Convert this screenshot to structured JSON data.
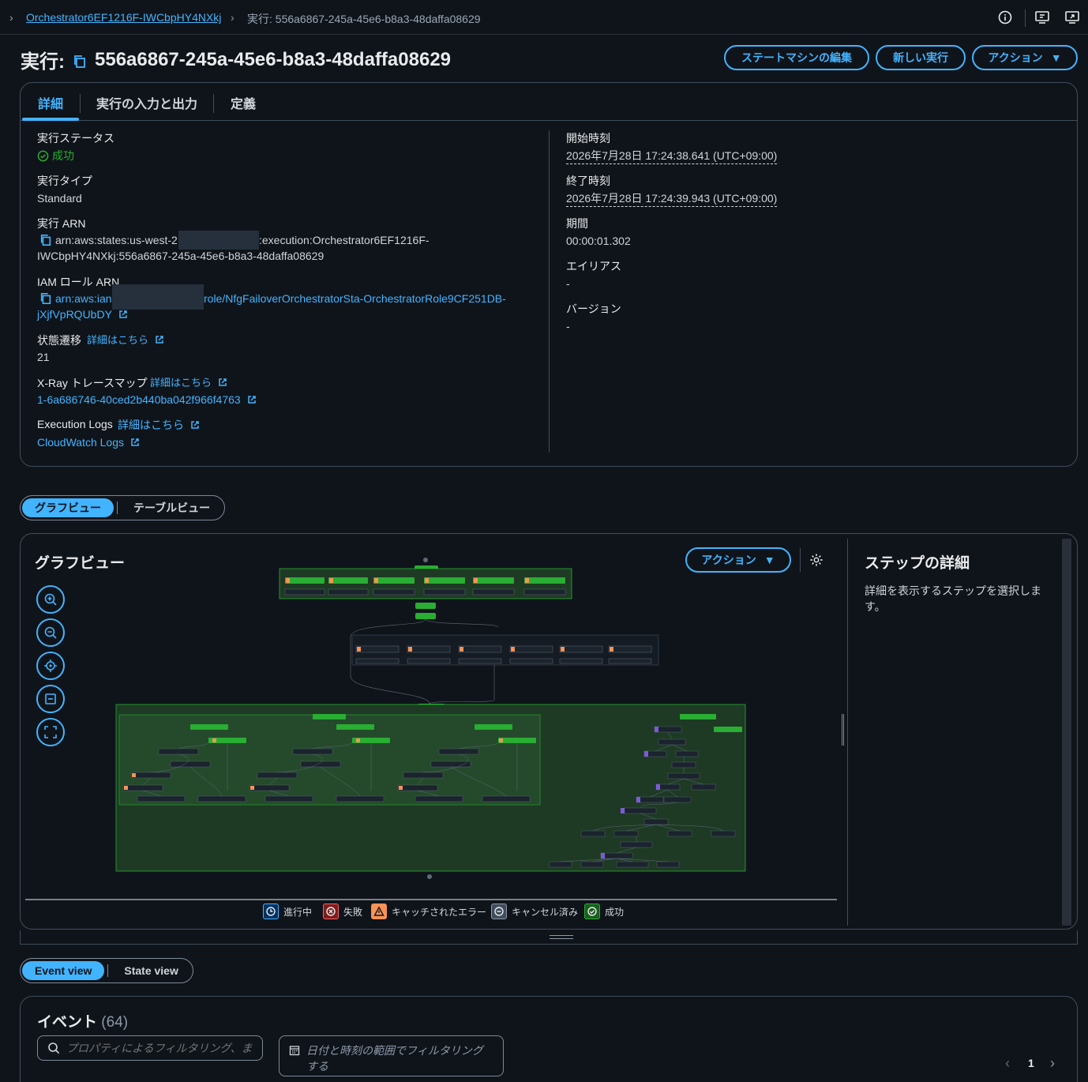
{
  "breadcrumb": {
    "parent": "Orchestrator6EF1216F-IWCbpHY4NXkj",
    "current": "実行: 556a6867-245a-45e6-b8a3-48daffa08629"
  },
  "header": {
    "title_prefix": "実行:",
    "execution_id": "556a6867-245a-45e6-b8a3-48daffa08629",
    "buttons": {
      "edit_state_machine": "ステートマシンの編集",
      "new_execution": "新しい実行",
      "actions": "アクション"
    }
  },
  "tabs": [
    "詳細",
    "実行の入力と出力",
    "定義"
  ],
  "details": {
    "status_label": "実行ステータス",
    "status_value": "成功",
    "type_label": "実行タイプ",
    "type_value": "Standard",
    "arn_label": "実行 ARN",
    "arn_line1_a": "arn:aws:states:us-west-2",
    "arn_line1_b": ":execution:Orchestrator6EF1216F-",
    "arn_line2": "IWCbpHY4NXkj:556a6867-245a-45e6-b8a3-48daffa08629",
    "iam_label": "IAM ロール ARN",
    "iam_line1_a": "arn:aws:ian",
    "iam_line1_b": "role/NfgFailoverOrchestratorSta-OrchestratorRole9CF251DB-",
    "iam_line2": "jXjfVpRQUbDY",
    "transitions_label": "状態遷移",
    "learn_more": "詳細はこちら",
    "transitions_value": "21",
    "xray_label": "X-Ray トレースマップ",
    "xray_value": "1-6a686746-40ced2b440ba042f966f4763",
    "logs_label": "Execution Logs",
    "logs_value": "CloudWatch Logs",
    "start_label": "開始時刻",
    "start_value": "2026年7月28日 17:24:38.641 (UTC+09:00)",
    "end_label": "終了時刻",
    "end_value": "2026年7月28日 17:24:39.943 (UTC+09:00)",
    "duration_label": "期間",
    "duration_value": "00:00:01.302",
    "alias_label": "エイリアス",
    "alias_value": "-",
    "version_label": "バージョン",
    "version_value": "-"
  },
  "view_toggle": {
    "graph": "グラフビュー",
    "table": "テーブルビュー"
  },
  "graph": {
    "title": "グラフビュー",
    "actions": "アクション",
    "legend": [
      "進行中",
      "失敗",
      "キャッチされたエラー",
      "キャンセル済み",
      "成功"
    ],
    "colors": {
      "success": "#29ad32",
      "caught": "#f89256",
      "task_purple": "#7c5cd6"
    }
  },
  "step_details": {
    "title": "ステップの詳細",
    "hint": "詳細を表示するステップを選択します。"
  },
  "event_toggle": {
    "event": "Event view",
    "state": "State view"
  },
  "events": {
    "title": "イベント",
    "count": "(64)",
    "filter_placeholder": "プロパティによるフィルタリング、ま",
    "date_filter": "日付と時刻の範囲でフィルタリングする",
    "page": "1"
  }
}
